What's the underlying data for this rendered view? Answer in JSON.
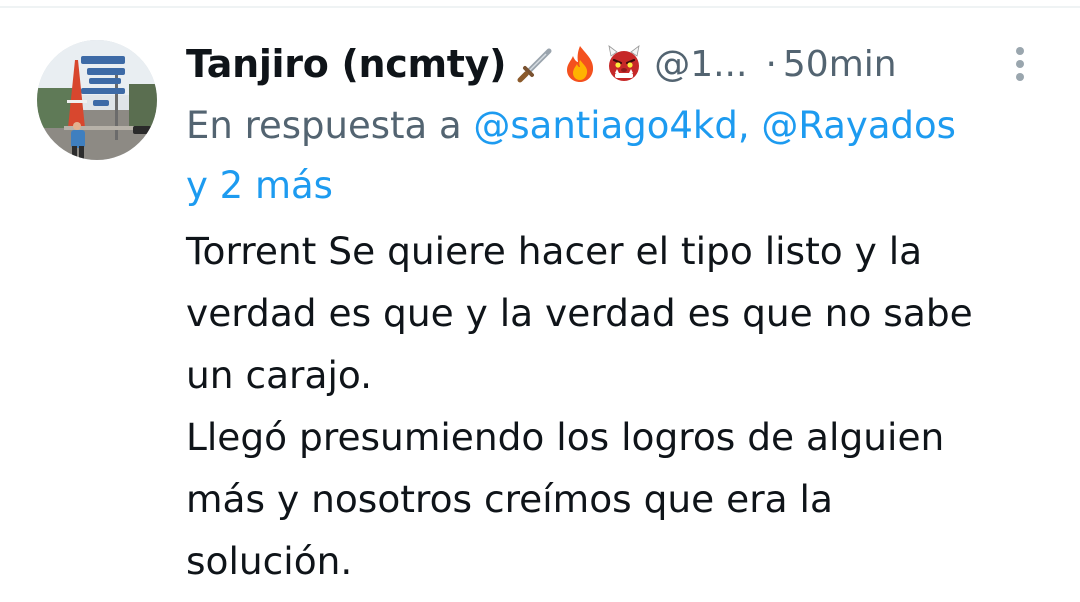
{
  "tweet": {
    "author": {
      "display_name": "Tanjiro (ncmty)",
      "emojis": [
        "dagger-icon",
        "fire-icon",
        "ogre-icon"
      ],
      "handle": "@1...",
      "avatar_icon": "avatar-photo"
    },
    "separator": "·",
    "timestamp": "50min",
    "more_icon": "more-vertical-icon",
    "reply_to": {
      "prefix": "En respuesta a",
      "mentions": [
        "@santiago4kd,",
        "@Rayados"
      ],
      "others": "y 2 más"
    },
    "body_lines": [
      "Torrent Se quiere hacer el tipo listo y la",
      "verdad es que y la verdad es que no sabe",
      "un carajo.",
      "Llegó presumiendo los logros de alguien",
      "más y nosotros creímos que era la",
      "solución."
    ]
  },
  "colors": {
    "text_primary": "#0f1419",
    "text_secondary": "#536471",
    "link": "#1d9bf0",
    "divider": "#eff3f4"
  }
}
